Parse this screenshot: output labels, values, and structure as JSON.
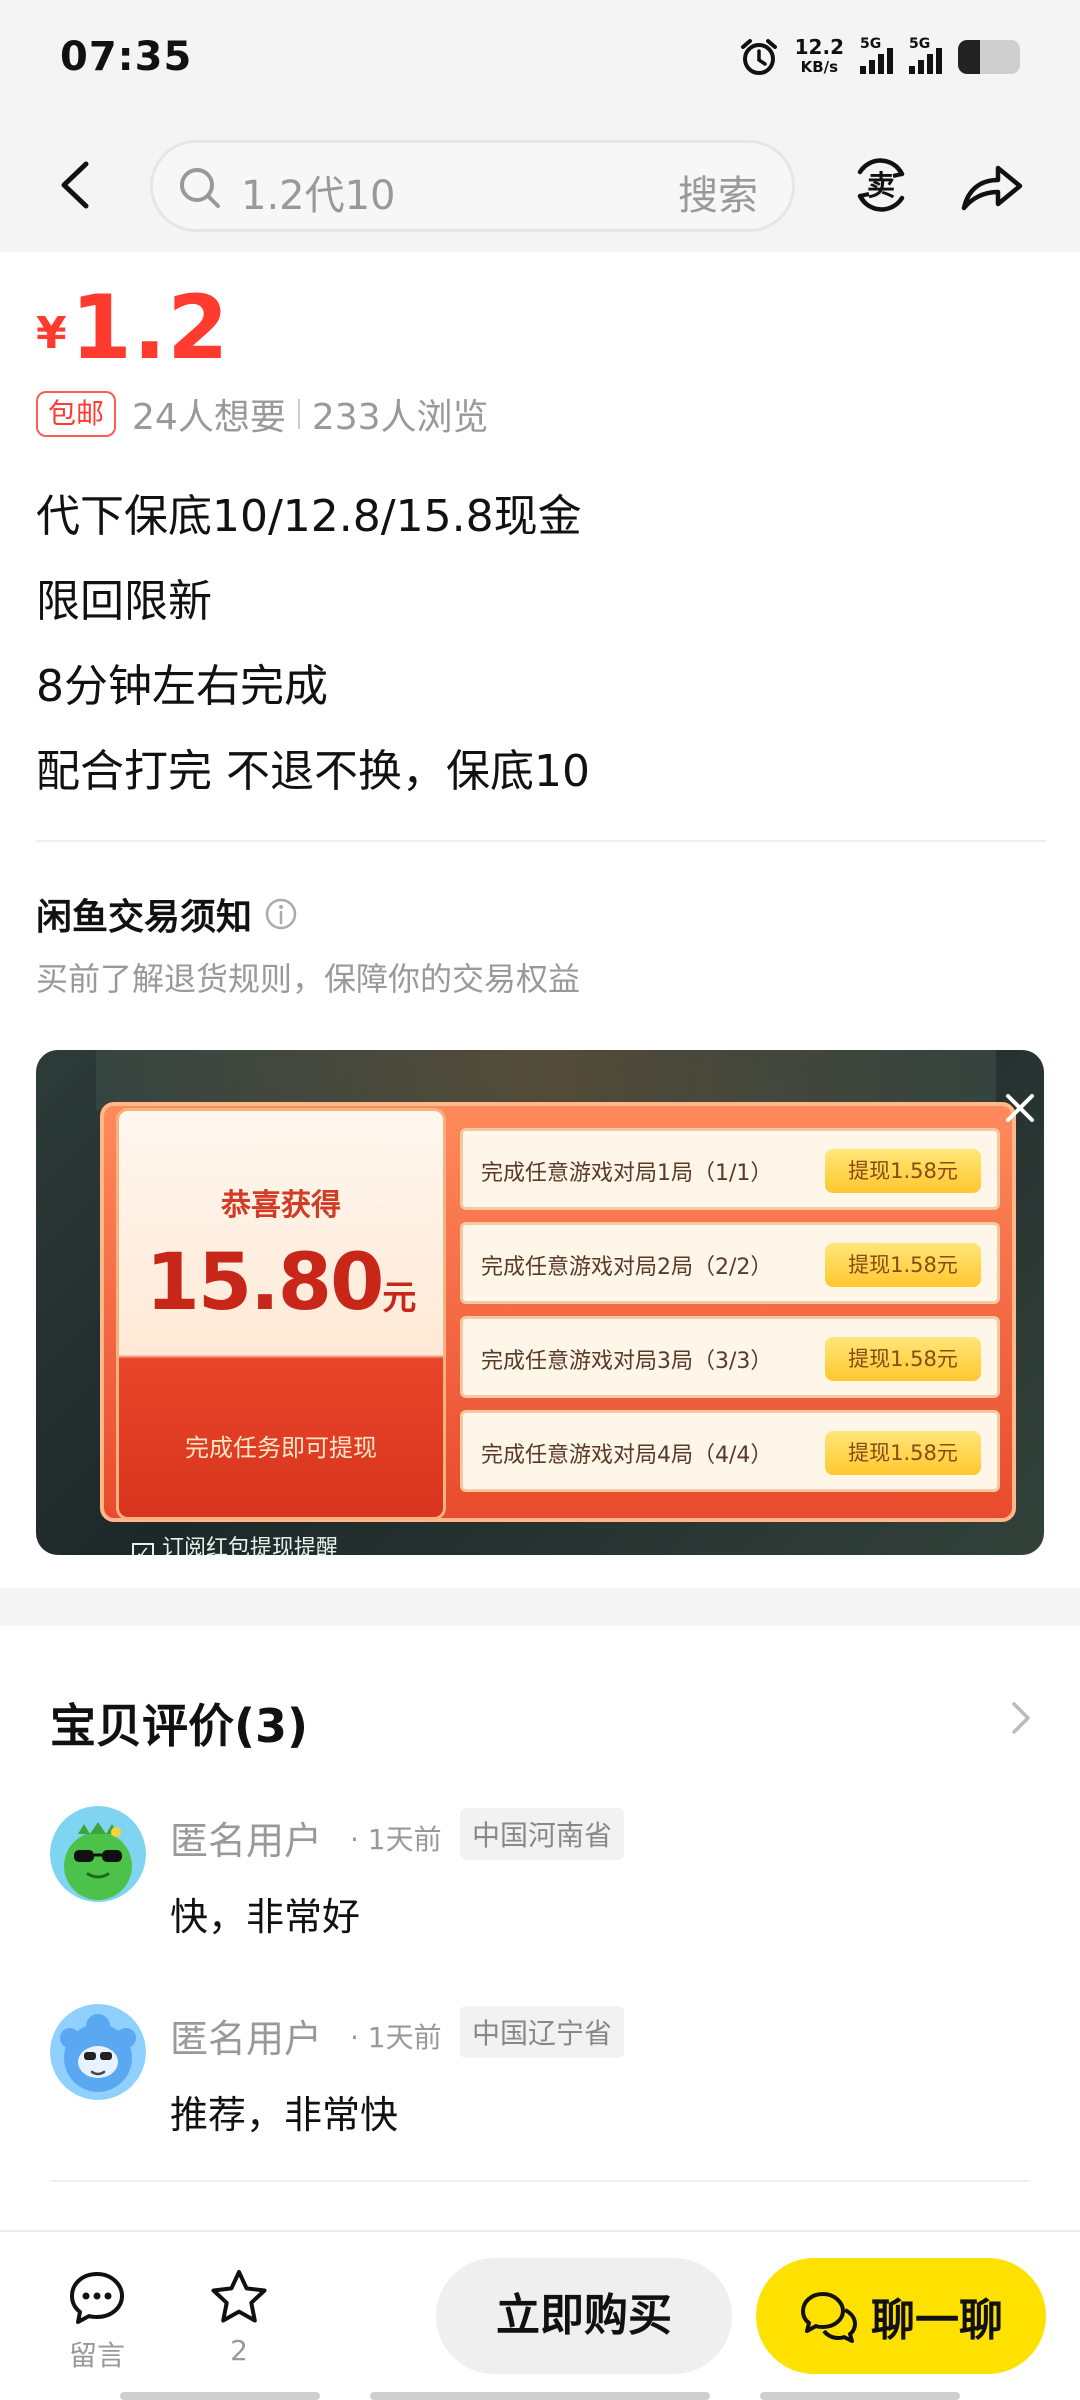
{
  "status_bar": {
    "time": "07:35",
    "net_speed": "12.2",
    "net_unit": "KB/s",
    "sig1_label": "5G",
    "sig2_label": "5G",
    "battery_level": 0.35
  },
  "nav": {
    "search_query": "1.2代10",
    "search_button": "搜索"
  },
  "product": {
    "currency": "¥",
    "price": "1.2",
    "shipping_badge": "包邮",
    "wants": "24人想要",
    "views": "233人浏览",
    "description": [
      "代下保底10/12.8/15.8现金",
      "限回限新",
      "8分钟左右完成",
      "配合打完 不退不换，保底10"
    ],
    "notice_title": "闲鱼交易须知",
    "notice_subtitle": "买前了解退货规则，保障你的交易权益"
  },
  "promo_image": {
    "congrats": "恭喜获得",
    "amount": "15.80",
    "amount_unit": "元",
    "hint": "完成任务即可提现",
    "tasks": [
      {
        "text": "完成任意游戏对局1局（1/1）",
        "button": "提现1.58元"
      },
      {
        "text": "完成任意游戏对局2局（2/2）",
        "button": "提现1.58元"
      },
      {
        "text": "完成任意游戏对局3局（3/3）",
        "button": "提现1.58元"
      },
      {
        "text": "完成任意游戏对局4局（4/4）",
        "button": "提现1.58元"
      }
    ],
    "checkbox_label": "订阅红包提现提醒"
  },
  "reviews": {
    "title": "宝贝评价(3)",
    "items": [
      {
        "name": "匿名用户",
        "time": "· 1天前",
        "location": "中国河南省",
        "text": "快，非常好"
      },
      {
        "name": "匿名用户",
        "time": "· 1天前",
        "location": "中国辽宁省",
        "text": "推荐，非常快"
      }
    ]
  },
  "bottom_bar": {
    "comment_label": "留言",
    "favorite_count": "2",
    "buy_label": "立即购买",
    "chat_label": "聊一聊"
  },
  "colors": {
    "price_red": "#ff3b30",
    "chat_yellow": "#ffe100"
  }
}
